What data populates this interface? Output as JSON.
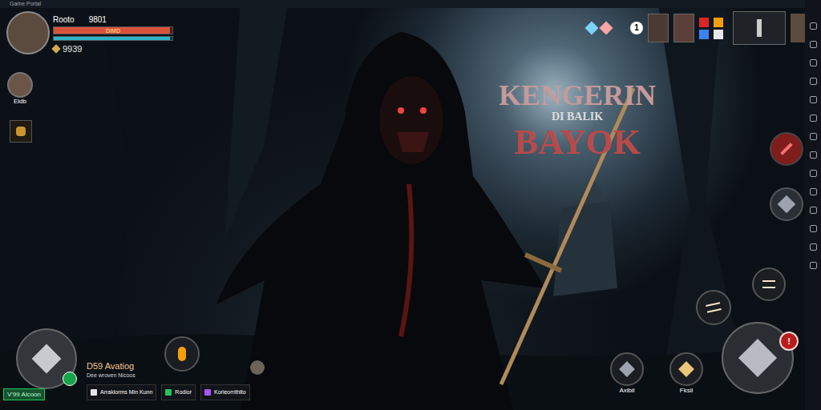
{
  "window": {
    "title": "Game Portal"
  },
  "player": {
    "name": "Rooto",
    "level": "9801",
    "health": {
      "level": 0.98,
      "reading": "DIMD"
    },
    "mana": {
      "level": 0.98
    },
    "gold": "9939"
  },
  "companion": {
    "label": "Eldb"
  },
  "title": {
    "line1": "KENGERIN",
    "line2": "DI BALIK",
    "line3": "BAYOK"
  },
  "top_badge": "1",
  "quest": {
    "title": "D59 Avatiog",
    "subtitle": "Dee wroven Nlcoos",
    "button": "V'99 Aicoon"
  },
  "bottom_tabs": [
    {
      "label": "Arraklorms Min Kunn",
      "color": "#e5e7eb"
    },
    {
      "label": "Rodior",
      "color": "#22c55e"
    },
    {
      "label": "Korleorrithlto",
      "color": "#a855f7"
    }
  ],
  "skills": [
    {
      "label": "Axibil"
    },
    {
      "label": "Fksil"
    }
  ],
  "attack_badge": "!"
}
